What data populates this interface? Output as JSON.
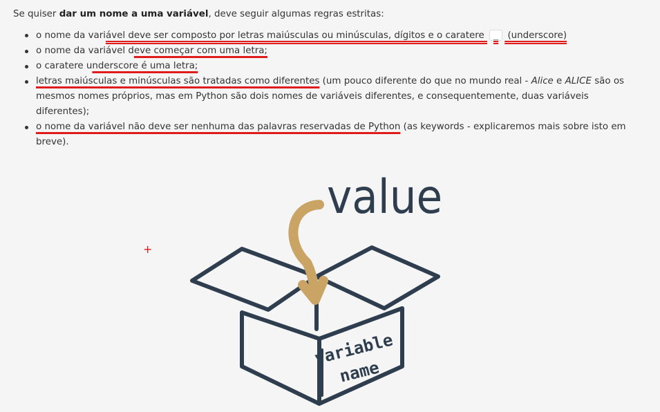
{
  "intro": {
    "prefix": "Se quiser ",
    "bold": "dar um nome a uma variável",
    "suffix": ", deve seguir algumas regras estritas:"
  },
  "rules": {
    "r1": {
      "pre": "o nome da vari",
      "underlined": "ável deve ser composto por letras maiúsculas ou minúsculas, dígitos e o caratere ",
      "code": "_",
      "post": " (underscore)"
    },
    "r2": {
      "pre": "o nome da variável d",
      "underlined": "eve começar com uma letra;"
    },
    "r3": {
      "pre": "o caratere u",
      "underlined": "nderscore é uma letra;"
    },
    "r4": {
      "underlined": "letras maiúsculas e minúsculas são tratadas como diferentes",
      "mid1": " (um pouco diferente do que no mundo real - ",
      "em1": "Alice",
      "mid2": " e ",
      "em2": "ALICE",
      "post": " são os mesmos nomes próprios, mas em Python são dois nomes de variáveis diferentes, e consequentemente, duas variáveis diferentes);"
    },
    "r5": {
      "underlined": "o nome da variável não deve ser nenhuma das palavras reservadas de Python",
      "post": " (as keywords - explicaremos mais sobre isto em breve)."
    }
  },
  "illustration": {
    "value_label": "value",
    "box_label_line1": "variable",
    "box_label_line2": "name",
    "box_color": "#2f3e4f",
    "arrow_color": "#c9a465"
  },
  "marker": {
    "symbol": "+",
    "color": "#e01b1b"
  }
}
